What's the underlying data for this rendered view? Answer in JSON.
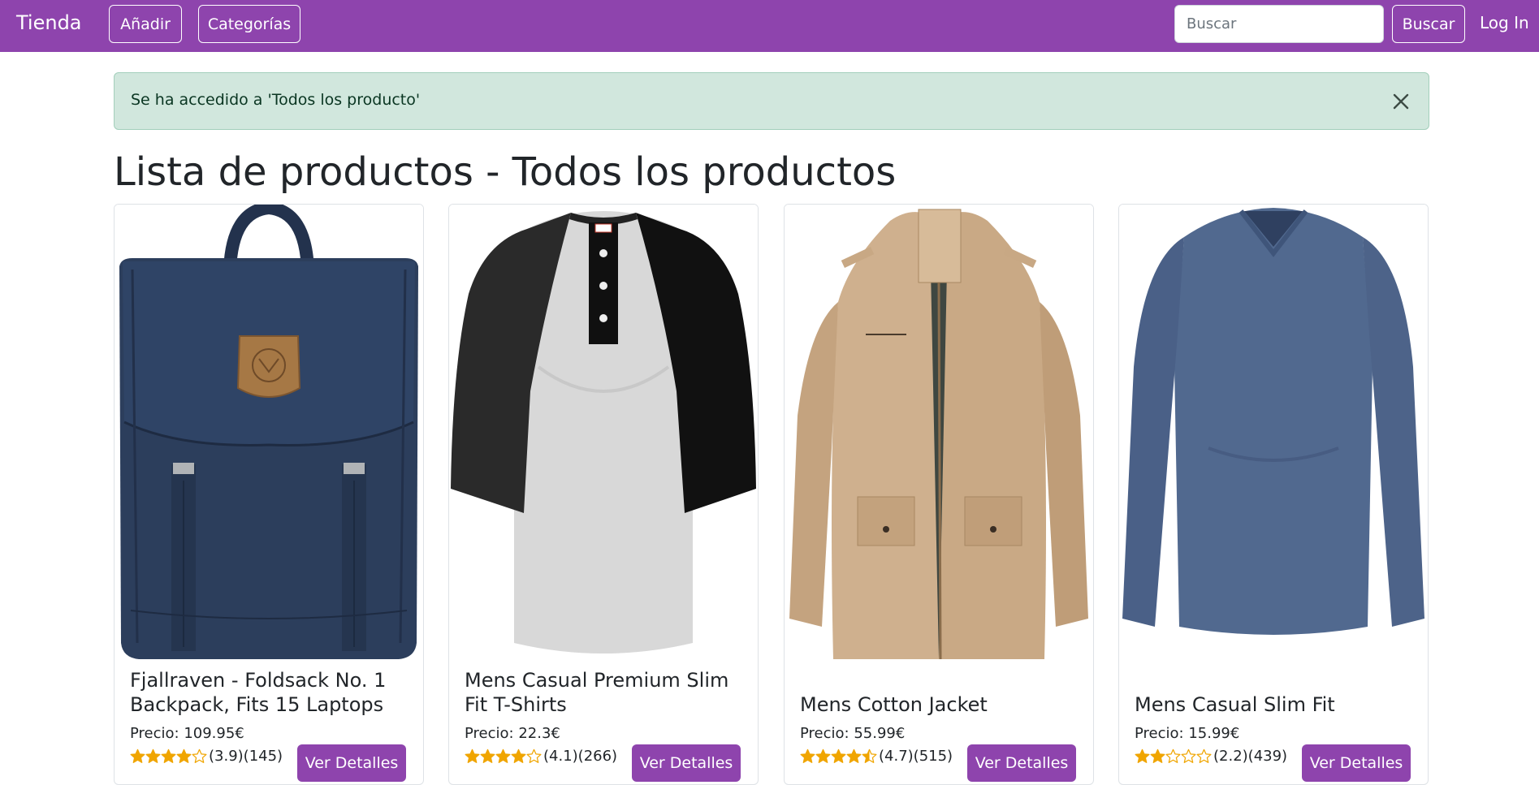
{
  "nav": {
    "brand": "Tienda",
    "add_label": "Añadir",
    "categories_label": "Categorías",
    "search_placeholder": "Buscar",
    "search_value": "",
    "search_button": "Buscar",
    "login_label": "Log In"
  },
  "alert": {
    "message": "Se ha accedido a 'Todos los producto'"
  },
  "page": {
    "title": "Lista de productos - Todos los productos"
  },
  "products": [
    {
      "title": "Fjallraven - Foldsack No. 1 Backpack, Fits 15 Laptops",
      "price": "Precio: 109.95€",
      "rating_text": "(3.9)(145)",
      "rating": 3.9,
      "button": "Ver Detalles",
      "image": "navy-backpack"
    },
    {
      "title": "Mens Casual Premium Slim Fit T-Shirts",
      "price": "Precio: 22.3€",
      "rating_text": "(4.1)(266)",
      "rating": 4.1,
      "button": "Ver Detalles",
      "image": "raglan-henley-shirt"
    },
    {
      "title": "Mens Cotton Jacket",
      "price": "Precio: 55.99€",
      "rating_text": "(4.7)(515)",
      "rating": 4.7,
      "button": "Ver Detalles",
      "image": "khaki-cotton-jacket"
    },
    {
      "title": "Mens Casual Slim Fit",
      "price": "Precio: 15.99€",
      "rating_text": "(2.2)(439)",
      "rating": 2.2,
      "button": "Ver Detalles",
      "image": "blue-long-sleeve-shirt"
    }
  ],
  "colors": {
    "brand": "#8e44ad",
    "alert_bg": "#d1e7dd",
    "star": "#f0a500"
  }
}
